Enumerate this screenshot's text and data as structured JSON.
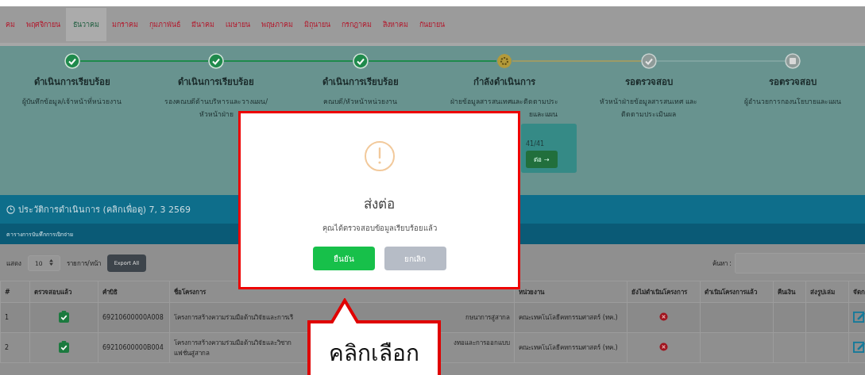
{
  "months": [
    {
      "label": "คม",
      "selected": false
    },
    {
      "label": "พฤศจิกายน",
      "selected": false
    },
    {
      "label": "ธันวาคม",
      "selected": true
    },
    {
      "label": "มกราคม",
      "selected": false
    },
    {
      "label": "กุมภาพันธ์",
      "selected": false
    },
    {
      "label": "มีนาคม",
      "selected": false
    },
    {
      "label": "เมษายน",
      "selected": false
    },
    {
      "label": "พฤษภาคม",
      "selected": false
    },
    {
      "label": "มิถุนายน",
      "selected": false
    },
    {
      "label": "กรกฎาคม",
      "selected": false
    },
    {
      "label": "สิงหาคม",
      "selected": false
    },
    {
      "label": "กันยายน",
      "selected": false
    }
  ],
  "steps": [
    {
      "kind": "done",
      "title": "ดำเนินการเรียบร้อย",
      "lines": [
        "ผู้บันทึกข้อมูล/เจ้าหน้าที่หน่วยงาน"
      ]
    },
    {
      "kind": "done",
      "title": "ดำเนินการเรียบร้อย",
      "lines": [
        "รองคณบดีด้านบริหารและวางแผน/",
        "หัวหน้าฝ่าย"
      ]
    },
    {
      "kind": "done",
      "title": "ดำเนินการเรียบร้อย",
      "lines": [
        "คณบดี/หัวหน้าหน่วยงาน"
      ]
    },
    {
      "kind": "current",
      "title": "กำลังดำเนินการ",
      "lines": [
        "ฝ่ายข้อมูลสารสนเทศและติดตามประ"
      ],
      "line_tail": "ยและแผน",
      "card": {
        "count": "41/41",
        "button": "ต่อ →"
      }
    },
    {
      "kind": "pending",
      "title": "รอตรวจสอบ",
      "lines": [
        "หัวหน้าฝ่ายข้อมูลสารสนเทศ และ",
        "ติดตามประเมินผล"
      ]
    },
    {
      "kind": "waiting",
      "title": "รอตรวจสอบ",
      "lines": [
        "ผู้อำนวยการกองนโยบายและแผน"
      ]
    }
  ],
  "history": {
    "title": "ประวัติการดำเนินการ (คลิกเพื่อดู) 7, 3 2569",
    "subtitle": "ตารางการบันทึกการเบิกจ่าย"
  },
  "table_controls": {
    "show_label": "แสดง",
    "page_size": "10",
    "per_page_label": "รายการ/หน้า",
    "export_button": "Export All",
    "search_label": "ค้นหา :"
  },
  "table": {
    "columns": [
      "#",
      "ตรวจสอบแล้ว",
      "คำบิธิ",
      "ชื่อโครงการ",
      "หน่วยงาน",
      "ยังไม่ดำเนินโครงการ",
      "ดำเนินโครงการแล้ว",
      "คืนเงิน",
      "ส่งรูปเล่ม",
      "จัดก"
    ],
    "rows": [
      {
        "no": "1",
        "checked": true,
        "code": "69210600000A008",
        "name": "โครงการสร้างความร่วมมือด้านวิจัยและการเรี",
        "name_end": "กษนาการสู่สากล",
        "unit": "คณะเทคโนโลยีคหกรรมศาสตร์ (ทค.)",
        "not_started": true
      },
      {
        "no": "2",
        "checked": true,
        "code": "69210600000B004",
        "name": "โครงการสร้างความร่วมมือด้านวิจัยและวิชาก",
        "name_end": "งทอและการออกแบบ",
        "name_line2": "แฟชั่นสู่สากล",
        "unit": "คณะเทคโนโลยีคหกรรมศาสตร์ (ทค.)",
        "not_started": true
      }
    ]
  },
  "dialog": {
    "title": "ส่งต่อ",
    "message": "คุณได้ตรวจสอบข้อมูลเรียบร้อยแล้ว",
    "confirm": "ยืนยัน",
    "cancel": "ยกเลิก"
  },
  "callout": {
    "text": "คลิกเลือก"
  }
}
